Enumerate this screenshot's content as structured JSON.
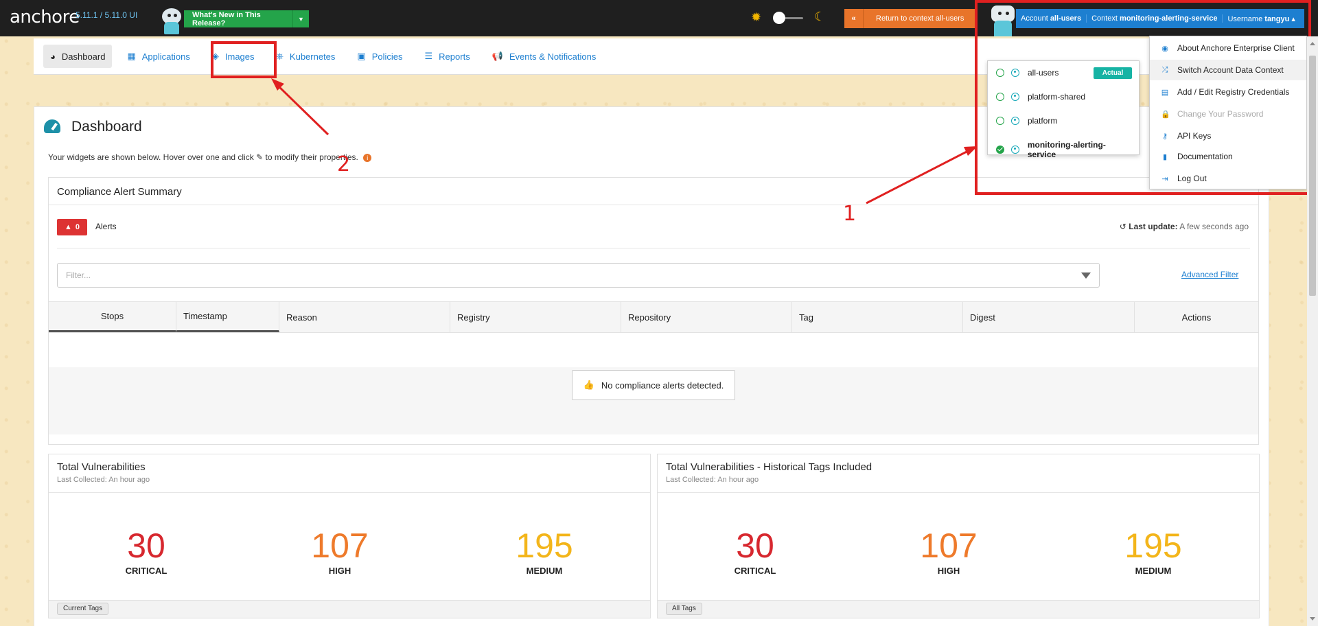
{
  "topbar": {
    "logo": "anchore",
    "version": "5.11.1 / 5.11.0 UI",
    "whats_new": "What's New in This Release?",
    "return_btn": "Return to context all-users",
    "account_label": "Account",
    "account_value": "all-users",
    "context_label": "Context",
    "context_value": "monitoring-alerting-service",
    "username_label": "Username",
    "username_value": "tangyu"
  },
  "nav": {
    "items": [
      {
        "label": "Dashboard",
        "icon": "dashboard-icon"
      },
      {
        "label": "Applications",
        "icon": "grid-icon"
      },
      {
        "label": "Images",
        "icon": "tags-icon"
      },
      {
        "label": "Kubernetes",
        "icon": "helm-icon"
      },
      {
        "label": "Policies",
        "icon": "briefcase-icon"
      },
      {
        "label": "Reports",
        "icon": "list-icon"
      },
      {
        "label": "Events & Notifications",
        "icon": "bullhorn-icon"
      }
    ]
  },
  "page": {
    "title": "Dashboard",
    "hint_before": "Your widgets are shown below. Hover over one and click",
    "hint_after": "to modify their properties."
  },
  "compliance": {
    "title": "Compliance Alert Summary",
    "alert_count": "0",
    "alerts_label": "Alerts",
    "last_update_label": "Last update:",
    "last_update_value": "A few seconds ago",
    "filter_placeholder": "Filter...",
    "advanced_filter": "Advanced Filter",
    "columns": [
      "Stops",
      "Timestamp",
      "Reason",
      "Registry",
      "Repository",
      "Tag",
      "Digest",
      "Actions"
    ],
    "empty_message": "No compliance alerts detected."
  },
  "vuln_widgets": [
    {
      "title": "Total Vulnerabilities",
      "subtitle": "Last Collected: An hour ago",
      "critical": "30",
      "high": "107",
      "medium": "195",
      "critical_label": "CRITICAL",
      "high_label": "HIGH",
      "medium_label": "MEDIUM",
      "tag": "Current Tags"
    },
    {
      "title": "Total Vulnerabilities - Historical Tags Included",
      "subtitle": "Last Collected: An hour ago",
      "critical": "30",
      "high": "107",
      "medium": "195",
      "critical_label": "CRITICAL",
      "high_label": "HIGH",
      "medium_label": "MEDIUM",
      "tag": "All Tags"
    }
  ],
  "context_menu": {
    "items": [
      {
        "name": "all-users",
        "selected": false
      },
      {
        "name": "platform-shared",
        "selected": false
      },
      {
        "name": "platform",
        "selected": false
      },
      {
        "name": "monitoring-alerting-service",
        "selected": true
      }
    ],
    "actual_tag": "Actual"
  },
  "user_menu": {
    "items": [
      {
        "label": "About Anchore Enterprise Client",
        "icon": "user-circle-icon"
      },
      {
        "label": "Switch Account Data Context",
        "icon": "shuffle-icon"
      },
      {
        "label": "Add / Edit Registry Credentials",
        "icon": "id-card-icon"
      },
      {
        "label": "Change Your Password",
        "icon": "lock-icon"
      },
      {
        "label": "API Keys",
        "icon": "key-icon"
      },
      {
        "label": "Documentation",
        "icon": "book-icon"
      },
      {
        "label": "Log Out",
        "icon": "sign-out-icon"
      }
    ]
  },
  "annotations": {
    "label_1": "1",
    "label_2": "2"
  },
  "colors": {
    "accent": "#1d7fd0",
    "orange": "#e8742a",
    "green": "#24a44a",
    "critical": "#d7282f",
    "high": "#ee7a2b",
    "medium": "#f3b51a",
    "annotation": "#e02020"
  }
}
